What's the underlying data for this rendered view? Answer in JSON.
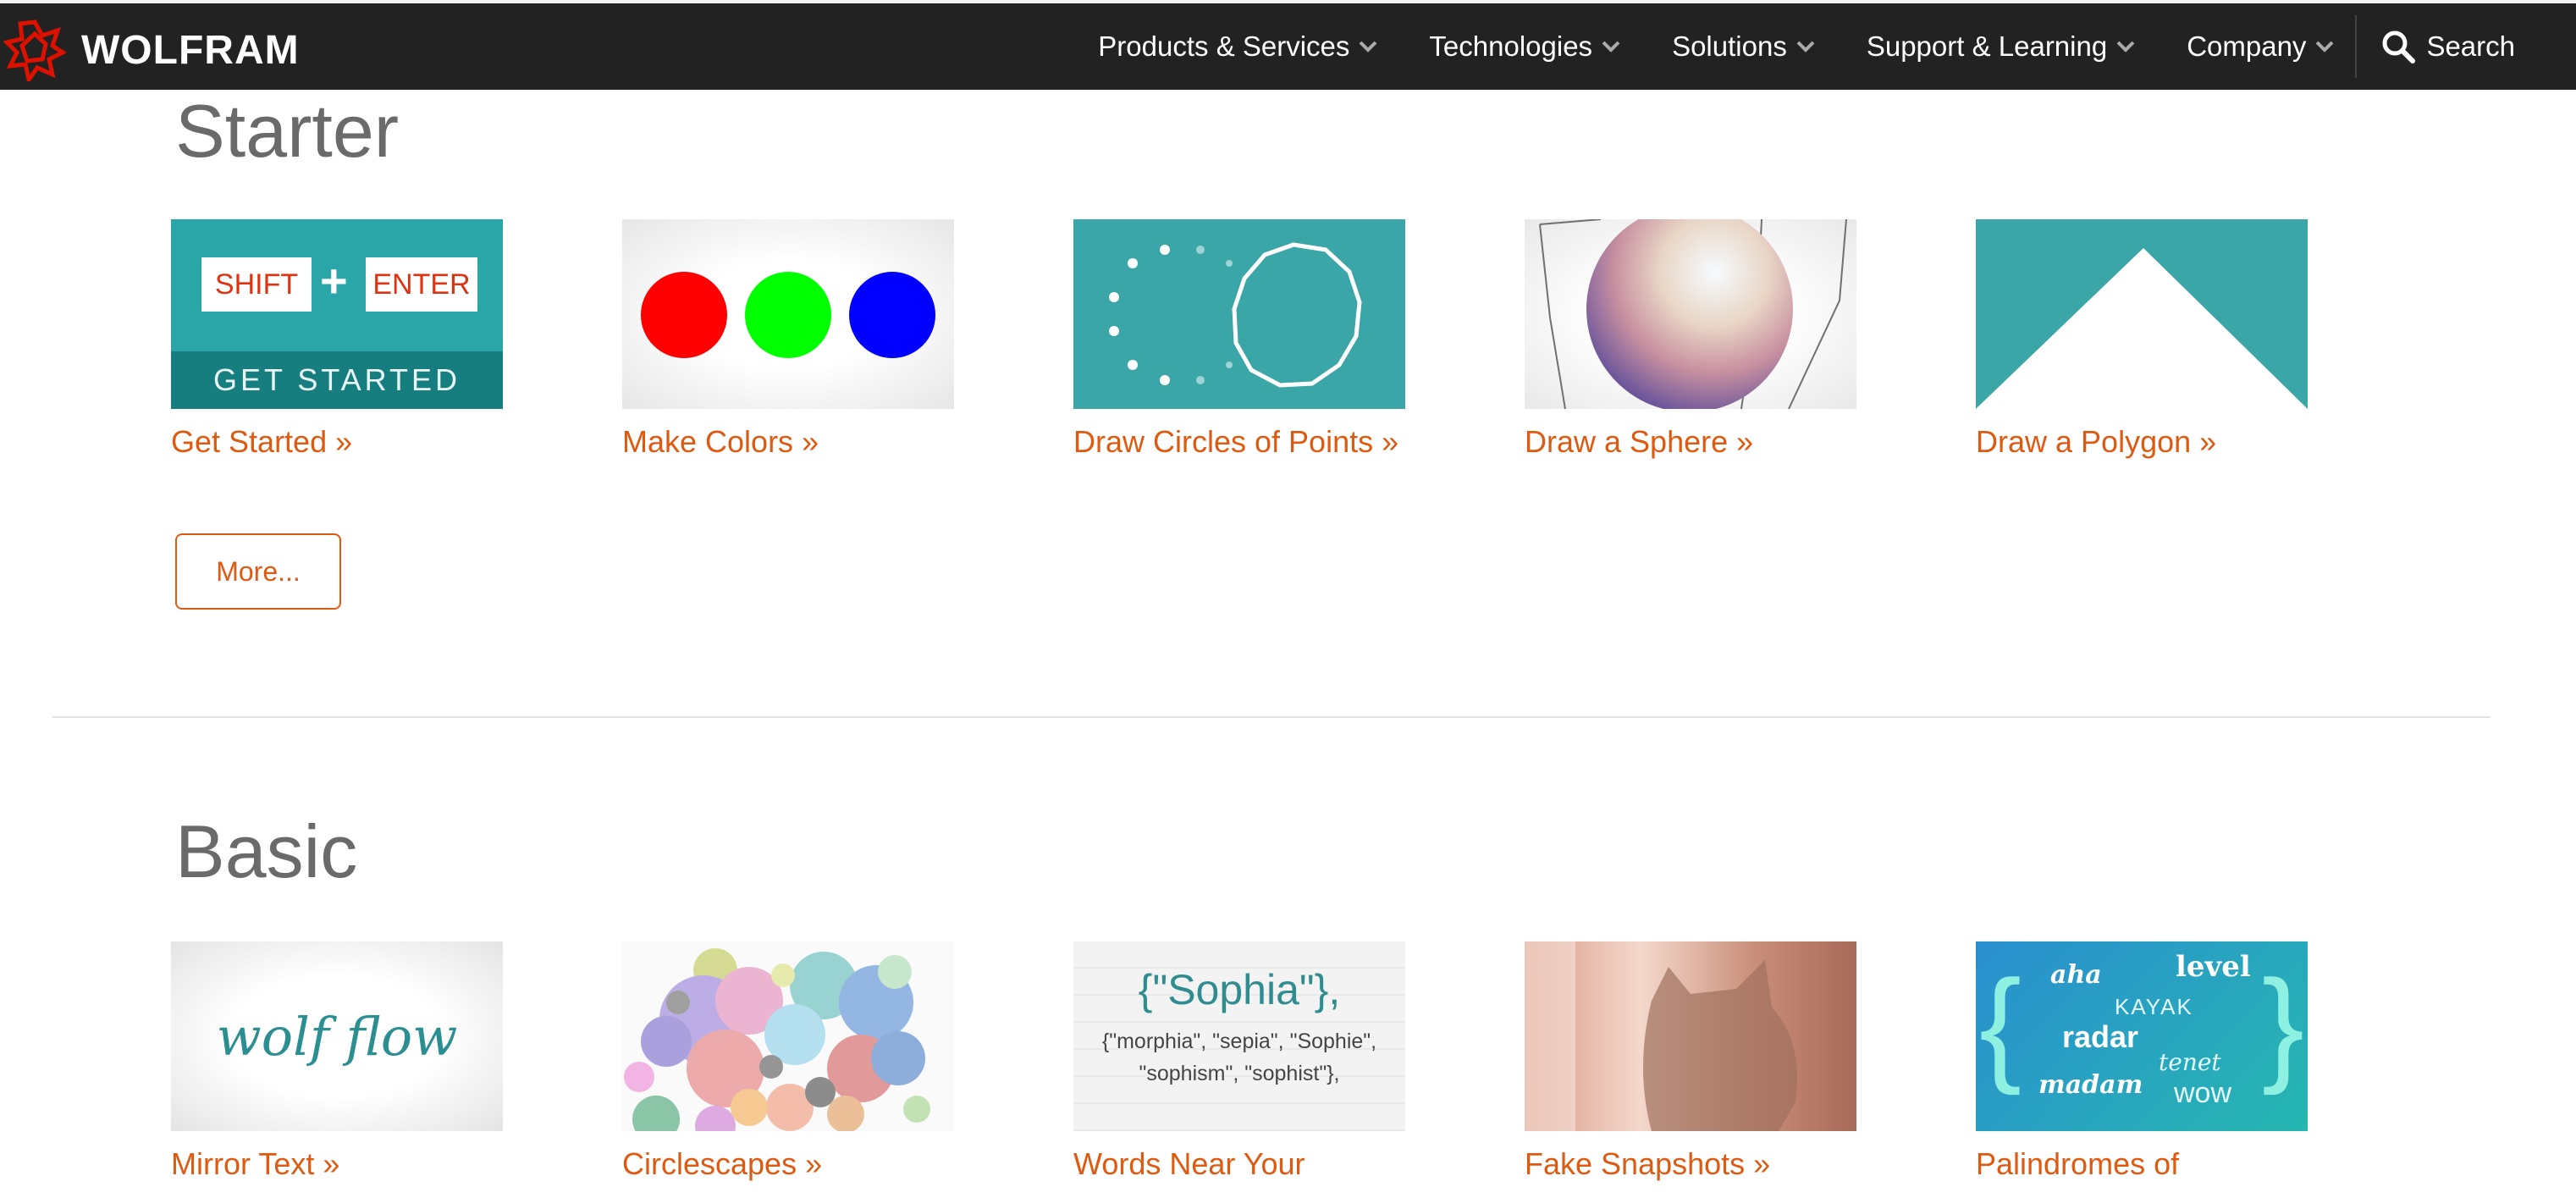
{
  "brand": {
    "name": "WOLFRAM",
    "accent": "#dd1100",
    "link_color": "#dd5a10",
    "bar_color": "#222222"
  },
  "nav": {
    "items": [
      {
        "label": "Products & Services"
      },
      {
        "label": "Technologies"
      },
      {
        "label": "Solutions"
      },
      {
        "label": "Support & Learning"
      },
      {
        "label": "Company"
      }
    ],
    "search_label": "Search",
    "chevron_icon": "chevron-down-icon",
    "search_icon": "search-icon"
  },
  "sections": [
    {
      "title": "Starter",
      "cards": [
        {
          "link": "Get Started »",
          "thumb": {
            "key1": "SHIFT",
            "plus": "+",
            "key2": "ENTER",
            "caption": "GET STARTED"
          }
        },
        {
          "link": "Make Colors »"
        },
        {
          "link": "Draw Circles of Points »"
        },
        {
          "link": "Draw a Sphere »"
        },
        {
          "link": "Draw a Polygon »"
        }
      ],
      "more_label": "More..."
    },
    {
      "title": "Basic",
      "cards": [
        {
          "link": "Mirror Text »",
          "thumb": {
            "text": "wolf flow"
          }
        },
        {
          "link": "Circlescapes »"
        },
        {
          "link": "Words Near Your",
          "thumb": {
            "line1": "{\"Sophia\"},",
            "line2": "{\"morphia\", \"sepia\", \"Sophie\",",
            "line3": "\"sophism\", \"sophist\"},"
          }
        },
        {
          "link": "Fake Snapshots »"
        },
        {
          "link": "Palindromes of",
          "thumb": {
            "w1": "aha",
            "w2": "level",
            "w3": "KAYAK",
            "w4": "radar",
            "w5": "tenet",
            "w6": "madam",
            "w7": "wow"
          }
        }
      ]
    }
  ]
}
